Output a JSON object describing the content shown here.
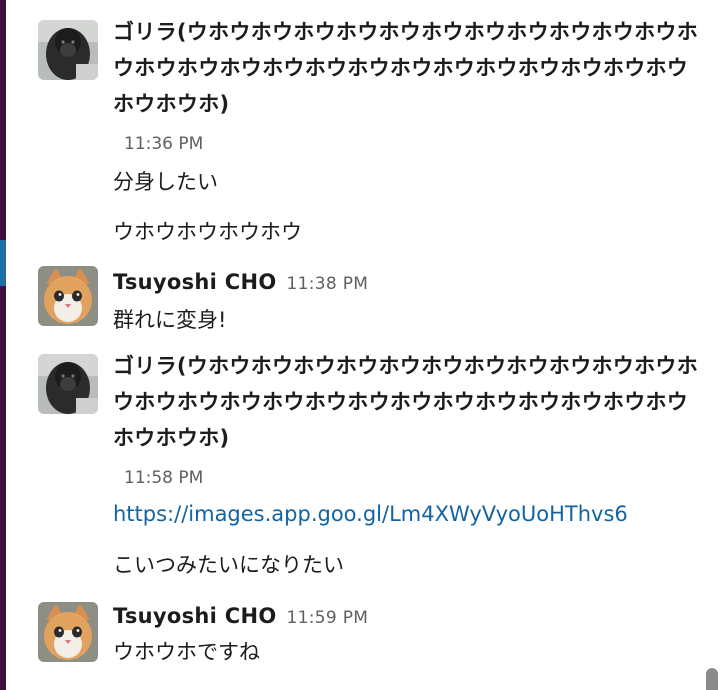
{
  "messages": [
    {
      "avatar": "gorilla-avatar",
      "name": "ゴリラ(ウホウホウホウホウホウホウホウホウホウホウホウホウホウホウホウホウホウホウホウホウホウホウホウホウホウホウホウホ)",
      "time": "11:36 PM",
      "lines": [
        "分身したい",
        "ウホウホウホウホウ"
      ]
    },
    {
      "avatar": "cat-avatar",
      "name": "Tsuyoshi CHO",
      "time": "11:38 PM",
      "lines": [
        "群れに変身!"
      ]
    },
    {
      "avatar": "gorilla-avatar",
      "name": "ゴリラ(ウホウホウホウホウホウホウホウホウホウホウホウホウホウホウホウホウホウホウホウホウホウホウホウホウホウホウホウホ)",
      "time": "11:58 PM",
      "lines": [
        "https://images.app.goo.gl/Lm4XWyVyoUoHThvs6",
        "こいつみたいになりたい"
      ]
    },
    {
      "avatar": "cat-avatar",
      "name": "Tsuyoshi CHO",
      "time": "11:59 PM",
      "lines": [
        "ウホウホですね"
      ]
    }
  ],
  "colors": {
    "sidebar": "#3f0e40",
    "accent": "#1d6fa5",
    "link": "#1264a3",
    "text": "#1d1c1d",
    "muted": "#616061"
  }
}
